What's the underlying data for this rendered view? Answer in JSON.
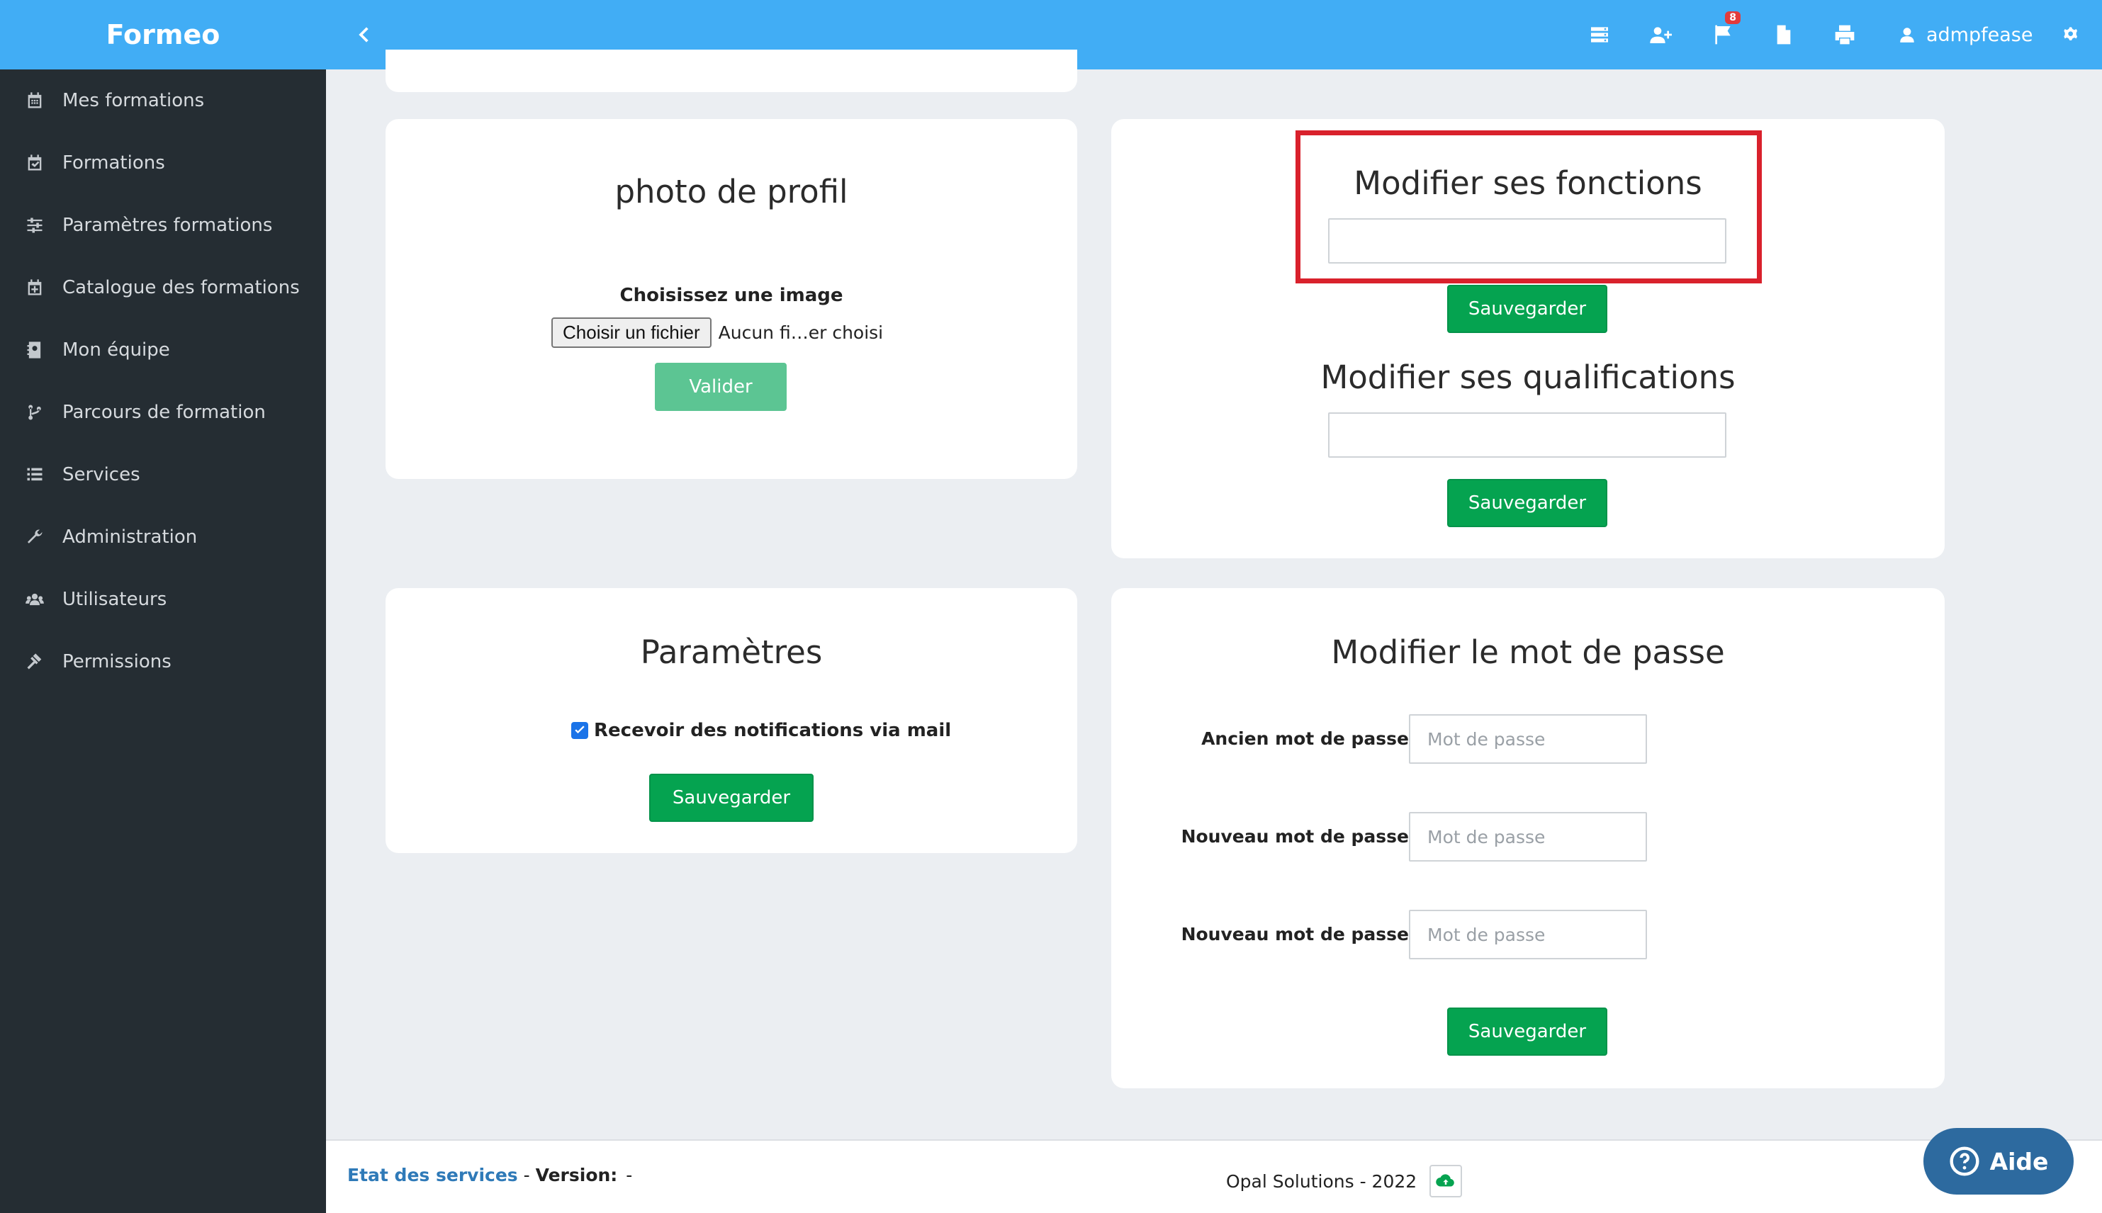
{
  "app": {
    "brand": "Formeo"
  },
  "sidebar": {
    "items": [
      {
        "label": "Mes formations",
        "icon": "calendar-icon"
      },
      {
        "label": "Formations",
        "icon": "calendar-check-icon"
      },
      {
        "label": "Paramètres formations",
        "icon": "sliders-icon"
      },
      {
        "label": "Catalogue des formations",
        "icon": "calendar-plus-icon"
      },
      {
        "label": "Mon équipe",
        "icon": "address-book-icon"
      },
      {
        "label": "Parcours de formation",
        "icon": "code-branch-icon"
      },
      {
        "label": "Services",
        "icon": "list-icon"
      },
      {
        "label": "Administration",
        "icon": "wrench-icon"
      },
      {
        "label": "Utilisateurs",
        "icon": "users-icon"
      },
      {
        "label": "Permissions",
        "icon": "gavel-icon"
      }
    ]
  },
  "topbar": {
    "notification_count": "8",
    "username": "admpfease"
  },
  "photo": {
    "title": "photo de profil",
    "choose_label": "Choisissez une image",
    "file_button": "Choisir un fichier",
    "file_status": "Aucun fi…er choisi",
    "submit": "Valider"
  },
  "fonctions": {
    "title": "Modifier ses fonctions",
    "value": "",
    "save": "Sauvegarder",
    "highlight_color": "#d9212c"
  },
  "qualifications": {
    "title": "Modifier ses qualifications",
    "value": "",
    "save": "Sauvegarder"
  },
  "parametres": {
    "title": "Paramètres",
    "notify_label": "Recevoir des notifications via mail",
    "notify_checked": true,
    "save": "Sauvegarder"
  },
  "password": {
    "title": "Modifier le mot de passe",
    "old_label": "Ancien mot de passe",
    "new_label": "Nouveau mot de passe",
    "confirm_label": "Nouveau mot de passe",
    "placeholder": "Mot de passe",
    "save": "Sauvegarder"
  },
  "footer": {
    "status_link": "Etat des services",
    "separator": " - ",
    "version_label": "Version:",
    "version_value": "-",
    "copyright": "Opal Solutions - 2022"
  },
  "help": {
    "label": "Aide"
  },
  "colors": {
    "topbar": "#41adf5",
    "sidebar": "#252d33",
    "primary_button": "#05a350",
    "link": "#2f7ab8"
  }
}
